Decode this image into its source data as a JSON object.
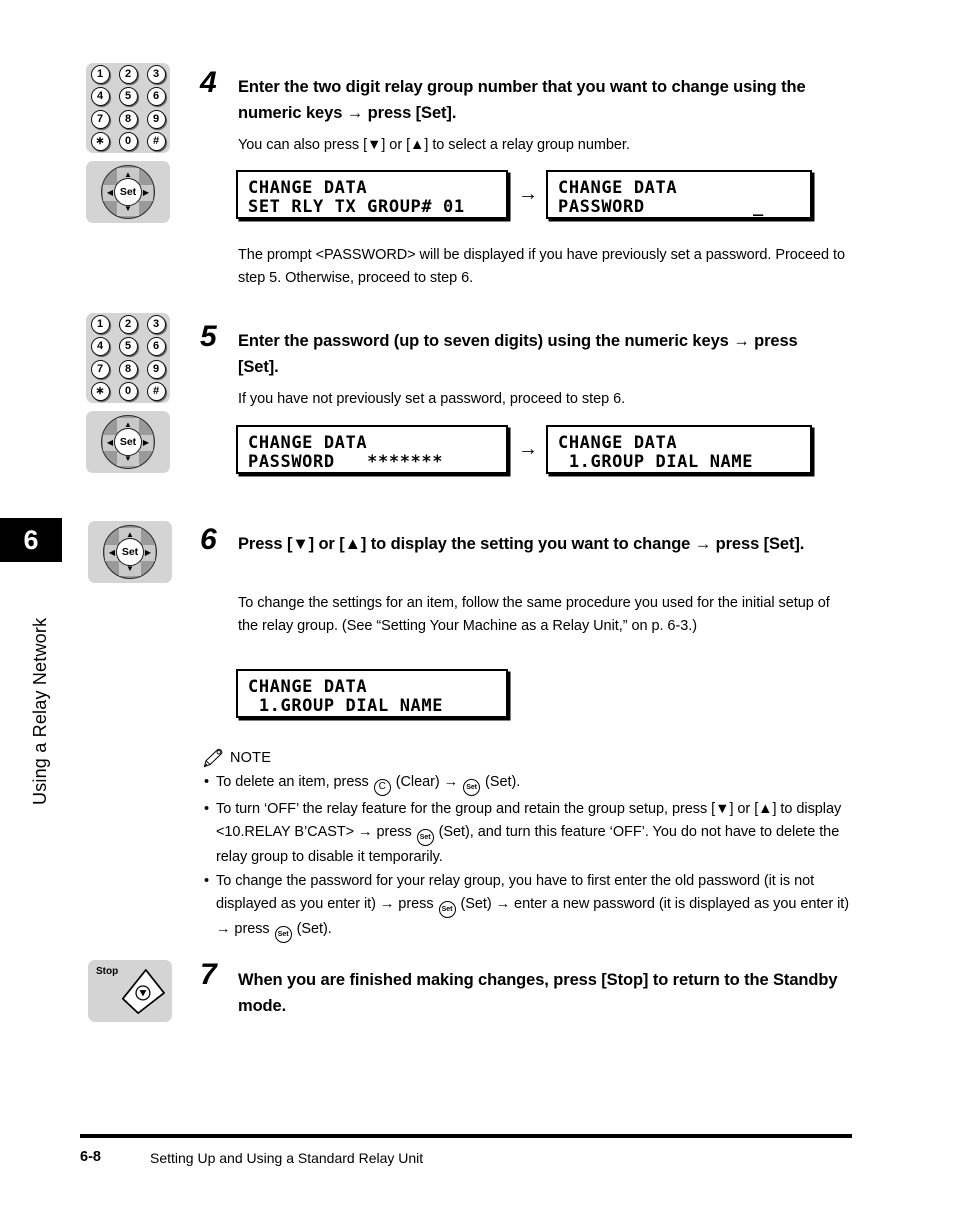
{
  "chapter_tab": {
    "number": "6",
    "title": "Using a Relay Network"
  },
  "steps": [
    {
      "number": "4",
      "heading": "Enter the two digit relay group number that you want to change using the numeric keys → press [Set].",
      "body": "You can also press [▼] or [▲] to select a relay group number.",
      "after_body": "The prompt <PASSWORD> will be displayed if you have previously set a password. Proceed to step 5. Otherwise, proceed to step 6.",
      "keypad_keys": [
        "1",
        "2",
        "3",
        "4",
        "5",
        "6",
        "7",
        "8",
        "9",
        "∗",
        "0",
        "#"
      ],
      "set_label": "Set",
      "lcd_left": {
        "line1": "CHANGE DATA",
        "line2": "SET RLY TX GROUP# 01"
      },
      "lcd_arrow": "→",
      "lcd_right": {
        "line1": "CHANGE DATA",
        "line2": "PASSWORD          _"
      }
    },
    {
      "number": "5",
      "heading": "Enter the password (up to seven digits) using the numeric keys → press [Set].",
      "body": "If you have not previously set a password, proceed to step 6.",
      "keypad_keys": [
        "1",
        "2",
        "3",
        "4",
        "5",
        "6",
        "7",
        "8",
        "9",
        "∗",
        "0",
        "#"
      ],
      "set_label": "Set",
      "lcd_left": {
        "line1": "CHANGE DATA",
        "line2": "PASSWORD   *******"
      },
      "lcd_arrow": "→",
      "lcd_right": {
        "line1": "CHANGE DATA",
        "line2": " 1.GROUP DIAL NAME"
      }
    },
    {
      "number": "6",
      "heading": "Press [▼] or [▲] to display the setting you want to change → press [Set].",
      "body": "To change the settings for an item, follow the same procedure you used for the initial setup of the relay group. (See “Setting Your Machine as a Relay Unit,” on p. 6-3.)",
      "set_label": "Set",
      "lcd_left": {
        "line1": "CHANGE DATA",
        "line2": " 1.GROUP DIAL NAME"
      }
    },
    {
      "number": "7",
      "heading": "When you are finished making changes, press [Stop] to return to the Standby mode.",
      "stop_label": "Stop"
    }
  ],
  "note": {
    "icon": "pencil-icon",
    "title": "NOTE",
    "items": [
      {
        "parts": [
          {
            "type": "text",
            "value": "To delete an item, press "
          },
          {
            "type": "key",
            "value": "C"
          },
          {
            "type": "text",
            "value": " (Clear) → "
          },
          {
            "type": "key",
            "value": "Set"
          },
          {
            "type": "text",
            "value": " (Set)."
          }
        ]
      },
      {
        "parts": [
          {
            "type": "text",
            "value": "To turn ‘OFF’ the relay feature for the group and retain the group setup, press [▼] or [▲] to display <10.RELAY B’CAST> → press "
          },
          {
            "type": "key",
            "value": "Set"
          },
          {
            "type": "text",
            "value": " (Set), and turn this feature ‘OFF’. You do not have to delete the relay group to disable it temporarily."
          }
        ]
      },
      {
        "parts": [
          {
            "type": "text",
            "value": "To change the password for your relay group, you have to first enter the old password (it is not displayed as you enter it) → press "
          },
          {
            "type": "key",
            "value": "Set"
          },
          {
            "type": "text",
            "value": " (Set) → enter a new password (it is displayed as you enter it) → press "
          },
          {
            "type": "key",
            "value": "Set"
          },
          {
            "type": "text",
            "value": " (Set)."
          }
        ]
      }
    ]
  },
  "footer": {
    "page_number": "6-8",
    "section_title": "Setting Up and Using a Standard Relay Unit"
  },
  "colors": {
    "key_panel_bg": "#d4d4d4",
    "pad_disc": "#9a9a9a",
    "pad_wedge": "#c9c9c9",
    "ink": "#000000"
  }
}
